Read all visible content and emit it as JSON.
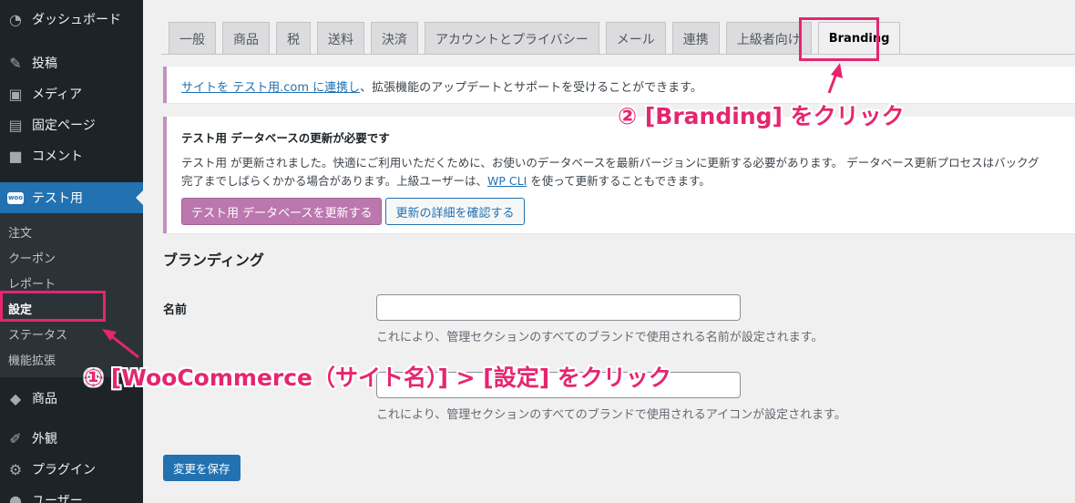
{
  "sidebar": {
    "top_items": [
      {
        "label": "ダッシュボード",
        "icon": "dashboard-icon"
      },
      {
        "label": "投稿",
        "icon": "pin-icon"
      },
      {
        "label": "メディア",
        "icon": "media-icon"
      },
      {
        "label": "固定ページ",
        "icon": "page-icon"
      },
      {
        "label": "コメント",
        "icon": "comment-icon"
      }
    ],
    "active_item": {
      "label": "テスト用",
      "badge": "woo"
    },
    "submenu": [
      "注文",
      "クーポン",
      "レポート",
      "設定",
      "ステータス",
      "機能拡張"
    ],
    "bottom_items": [
      {
        "label": "商品",
        "icon": "box-icon"
      },
      {
        "label": "外観",
        "icon": "brush-icon"
      },
      {
        "label": "プラグイン",
        "icon": "plugin-icon"
      },
      {
        "label": "ユーザー",
        "icon": "user-icon"
      }
    ]
  },
  "tabs": [
    "一般",
    "商品",
    "税",
    "送料",
    "決済",
    "アカウントとプライバシー",
    "メール",
    "連携",
    "上級者向け",
    "Branding"
  ],
  "notice1": {
    "link": "サイトを テスト用.com に連携し",
    "text": "、拡張機能のアップデートとサポートを受けることができます。"
  },
  "notice2": {
    "title": "テスト用 データベースの更新が必要です",
    "line1": "テスト用 が更新されました。快適にご利用いただくために、お使いのデータベースを最新バージョンに更新する必要があります。 データベース更新プロセスはバックグ",
    "line2_pre": "完了までしばらくかかる場合があります。上級ユーザーは、",
    "line2_link": "WP CLI",
    "line2_post": " を使って更新することもできます。",
    "btn_update": "テスト用 データベースを更新する",
    "btn_details": "更新の詳細を確認する"
  },
  "branding": {
    "title": "ブランディング",
    "name_label": "名前",
    "name_value": "",
    "name_desc": "これにより、管理セクションのすべてのブランドで使用される名前が設定されます。",
    "icon_value": "",
    "icon_desc": "これにより、管理セクションのすべてのブランドで使用されるアイコンが設定されます。",
    "save": "変更を保存"
  },
  "annotations": {
    "step1": "① [WooCommerce（サイト名）] > [設定] をクリック",
    "step2": "② [Branding] をクリック",
    "color": "#e5266f"
  }
}
